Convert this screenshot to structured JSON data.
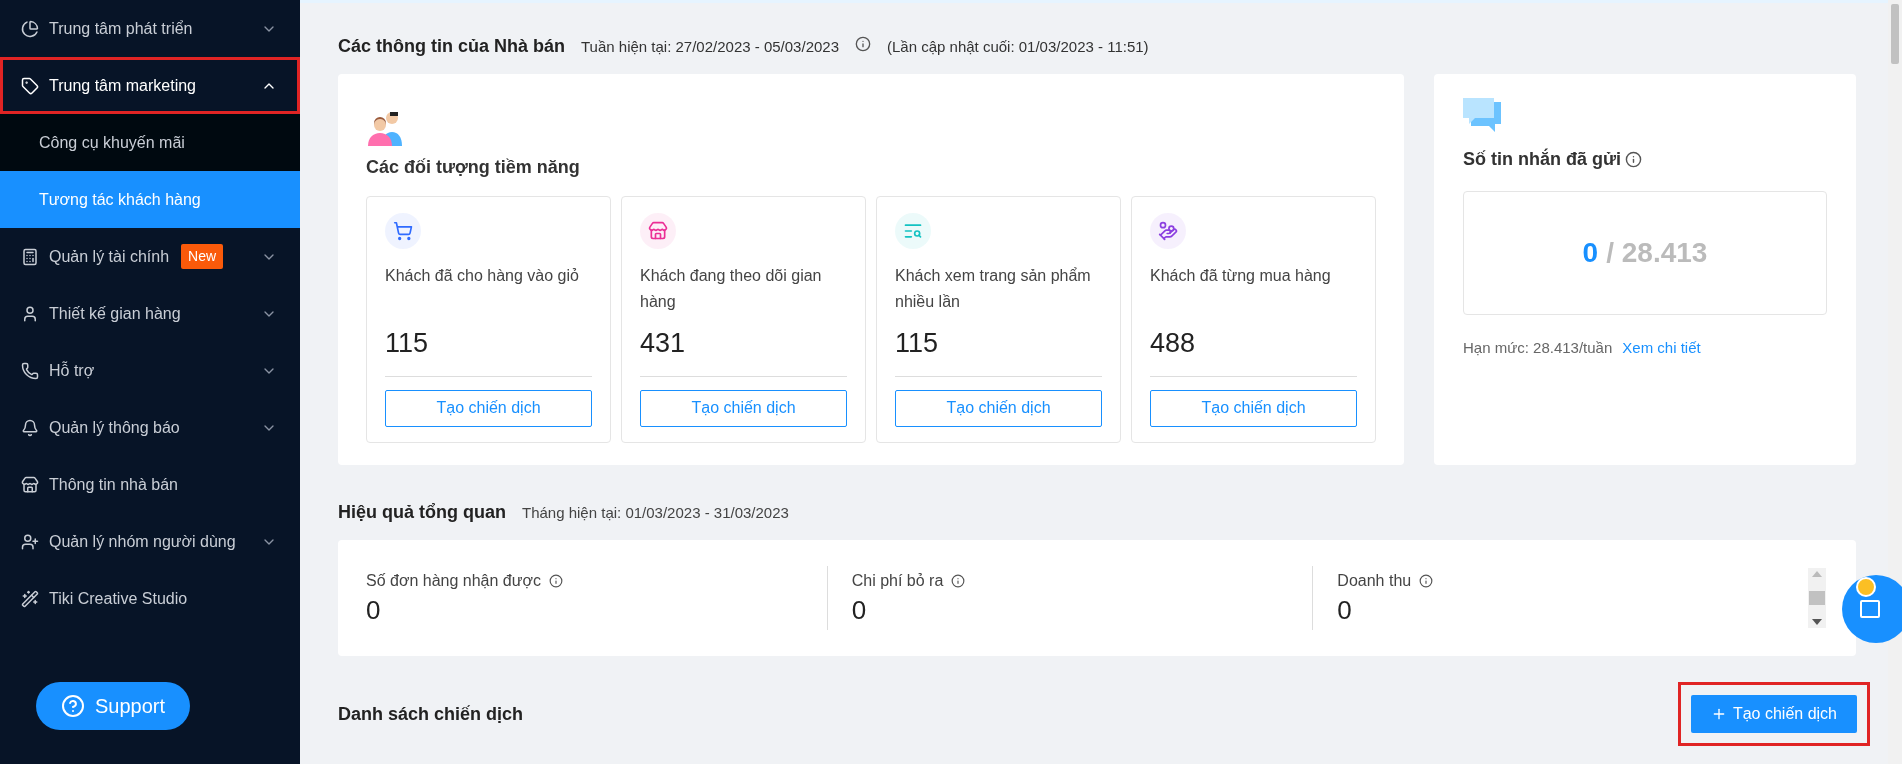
{
  "sidebar": {
    "items": [
      {
        "label": "Trung tâm phát triển",
        "expanded": false,
        "selected": false,
        "highlighted": false
      },
      {
        "label": "Trung tâm marketing",
        "expanded": true,
        "selected": false,
        "highlighted": true,
        "children": [
          {
            "label": "Công cụ khuyến mãi",
            "selected": false
          },
          {
            "label": "Tương tác khách hàng",
            "selected": true
          }
        ]
      },
      {
        "label": "Quản lý tài chính",
        "badge": "New",
        "expanded": false,
        "selected": false,
        "highlighted": false
      },
      {
        "label": "Thiết kế gian hàng",
        "expanded": false,
        "selected": false,
        "highlighted": false
      },
      {
        "label": "Hỗ trợ",
        "expanded": false,
        "selected": false,
        "highlighted": false
      },
      {
        "label": "Quản lý thông báo",
        "expanded": false,
        "selected": false,
        "highlighted": false
      },
      {
        "label": "Thông tin nhà bán",
        "selected": false,
        "highlighted": false
      },
      {
        "label": "Quản lý nhóm người dùng",
        "expanded": false,
        "selected": false,
        "highlighted": false
      },
      {
        "label": "Tiki Creative Studio",
        "selected": false,
        "highlighted": false
      }
    ],
    "support_button": "Support"
  },
  "seller_info": {
    "title": "Các thông tin của Nhà bán",
    "week": "Tuần hiện tại: 27/02/2023 - 05/03/2023",
    "updated": "(Lần cập nhật cuối: 01/03/2023 - 11:51)",
    "audiences": {
      "title": "Các đối tượng tiềm năng",
      "cards": [
        {
          "label": "Khách đã cho hàng vào giỏ",
          "value": "115",
          "button": "Tạo chiến dịch",
          "color": "#2f6bff"
        },
        {
          "label": "Khách đang theo dõi gian hàng",
          "value": "431",
          "button": "Tạo chiến dịch",
          "color": "#eb2f96"
        },
        {
          "label": "Khách xem trang sản phẩm nhiều lần",
          "value": "115",
          "button": "Tạo chiến dịch",
          "color": "#13c2c2"
        },
        {
          "label": "Khách đã từng mua hàng",
          "value": "488",
          "button": "Tạo chiến dịch",
          "color": "#8c3fe0"
        }
      ]
    },
    "messages": {
      "title": "Số tin nhắn đã gửi",
      "sent": "0",
      "limit": "/ 28.413",
      "quota": "Hạn mức: 28.413/tuần",
      "link": "Xem chi tiết"
    }
  },
  "overview": {
    "title": "Hiệu quả tổng quan",
    "period": "Tháng hiện tại: 01/03/2023 - 31/03/2023",
    "metrics": [
      {
        "label": "Số đơn hàng nhận được",
        "value": "0"
      },
      {
        "label": "Chi phí bỏ ra",
        "value": "0"
      },
      {
        "label": "Doanh thu",
        "value": "0"
      }
    ]
  },
  "campaigns": {
    "title": "Danh sách chiến dịch",
    "create_button": "Tạo chiến dịch",
    "highlighted": true
  }
}
